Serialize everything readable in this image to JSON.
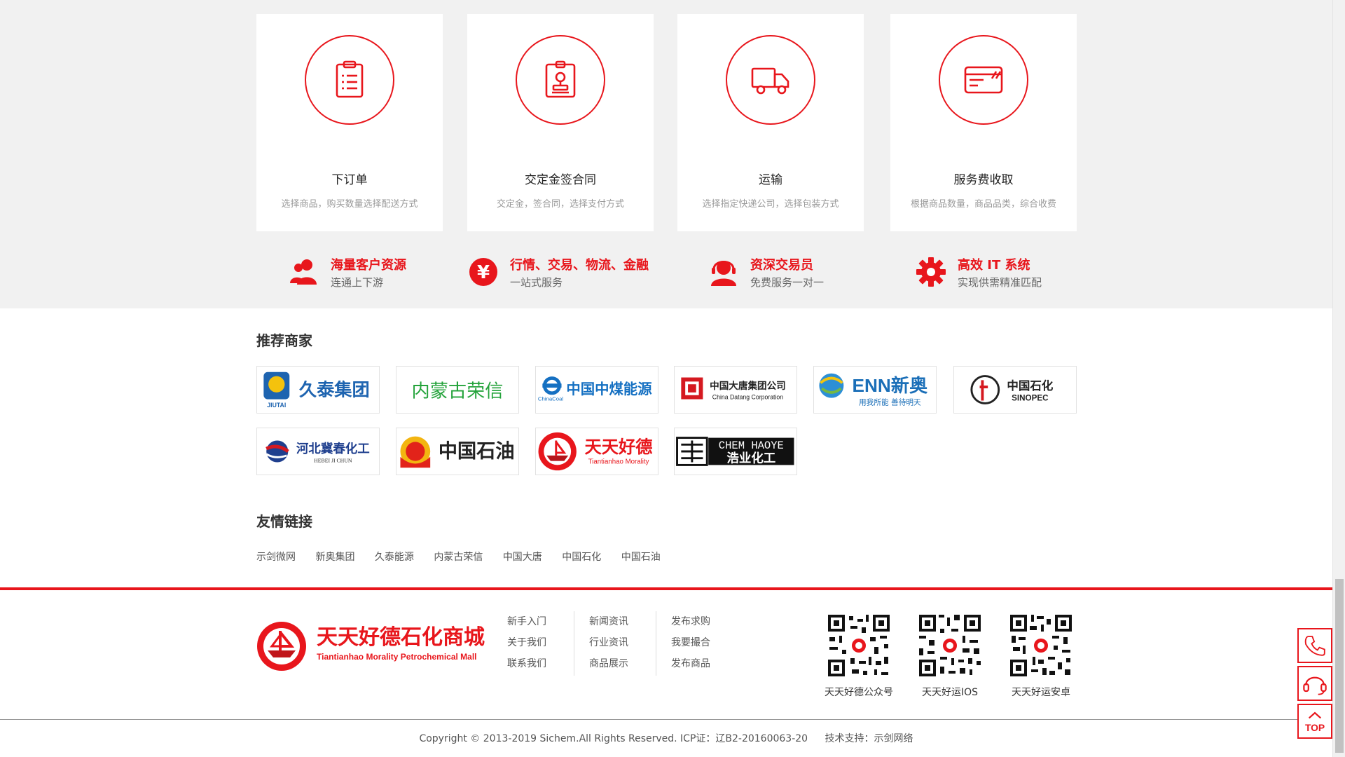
{
  "steps": [
    {
      "title": "下订单",
      "desc": "选择商品，购买数量选择配送方式",
      "icon": "clipboard-list-icon"
    },
    {
      "title": "交定金签合同",
      "desc": "交定金，签合同，选择支付方式",
      "icon": "contract-stamp-icon"
    },
    {
      "title": "运输",
      "desc": "选择指定快递公司，选择包装方式",
      "icon": "truck-icon"
    },
    {
      "title": "服务费收取",
      "desc": "根据商品数量，商品品类，综合收费",
      "icon": "credit-card-icon"
    }
  ],
  "features": [
    {
      "title": "海量客户资源",
      "sub": "连通上下游",
      "icon": "users-icon"
    },
    {
      "title": "行情、交易、物流、金融",
      "sub": "一站式服务",
      "icon": "yuan-icon"
    },
    {
      "title": "资深交易员",
      "sub": "免费服务一对一",
      "icon": "headset-agent-icon"
    },
    {
      "title": "高效 IT 系统",
      "sub": "实现供需精准匹配",
      "icon": "gear-icon"
    }
  ],
  "merchants_title": "推荐商家",
  "merchants": [
    {
      "name": "久泰集团",
      "en": "JIUTAI"
    },
    {
      "name": "内蒙古荣信",
      "en": ""
    },
    {
      "name": "中国中煤能源",
      "en": "ChinaCoal"
    },
    {
      "name": "中国大唐集团公司",
      "en": "China Datang Corporation"
    },
    {
      "name": "ENN新奥",
      "en": "用我所能 善待明天"
    },
    {
      "name": "中国石化",
      "en": "SINOPEC"
    },
    {
      "name": "河北冀春化工",
      "en": "HEBEI JI CHUN"
    },
    {
      "name": "中国石油",
      "en": ""
    },
    {
      "name": "天天好德",
      "en": "Tiantianhao Morality"
    },
    {
      "name": "浩业化工",
      "en": "CHEM HAOYE"
    }
  ],
  "links_title": "友情链接",
  "links": [
    "示剑微网",
    "新奥集团",
    "久泰能源",
    "内蒙古荣信",
    "中国大唐",
    "中国石化",
    "中国石油"
  ],
  "footer": {
    "logo_cn": "天天好德石化商城",
    "logo_en": "Tiantianhao Morality Petrochemical Mall",
    "col1": [
      "新手入门",
      "关于我们",
      "联系我们"
    ],
    "col2": [
      "新闻资讯",
      "行业资讯",
      "商品展示"
    ],
    "col3": [
      "发布求购",
      "我要撮合",
      "发布商品"
    ],
    "qrs": [
      "天天好德公众号",
      "天天好运IOS",
      "天天好运安卓"
    ],
    "copyright": "Copyright © 2013-2019 Sichem.All Rights Reserved. ICP证：辽B2-20160063-20",
    "tech": "技术支持：示剑网络"
  },
  "side": {
    "top_label": "TOP"
  },
  "colors": {
    "accent": "#e8161c",
    "gray_bg": "#f1f1f1"
  }
}
